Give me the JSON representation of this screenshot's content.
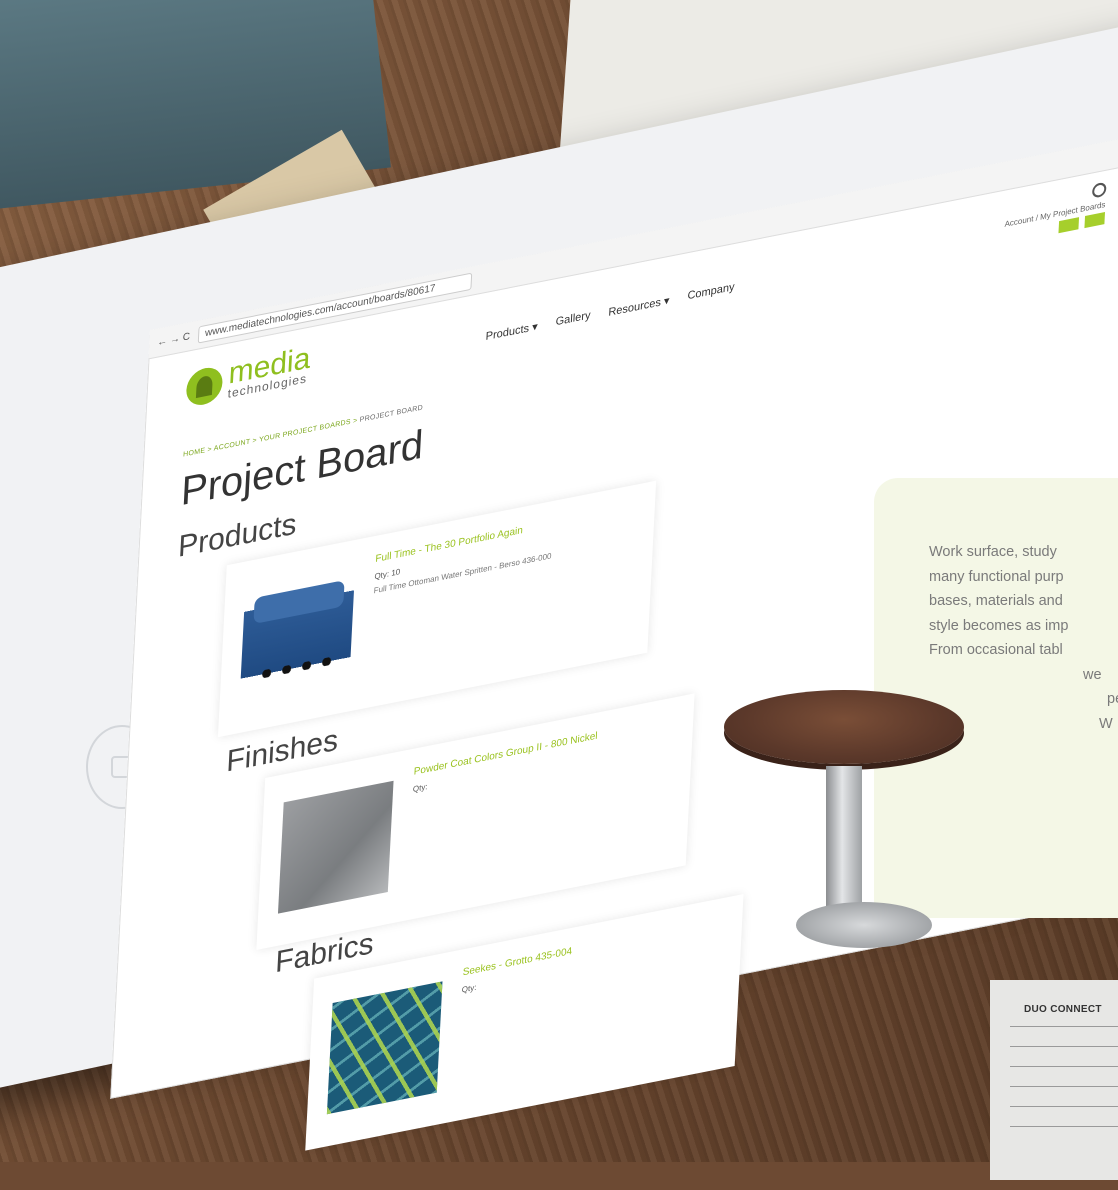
{
  "browser": {
    "url": "www.mediatechnologies.com/account/boards/80617",
    "nav_glyphs": "← → C"
  },
  "site": {
    "logo_main": "media",
    "logo_sub": "technologies",
    "nav": [
      "Products",
      "Gallery",
      "Resources",
      "Company"
    ],
    "account_link": "Account / My Project Boards",
    "buttons": [
      "",
      ""
    ]
  },
  "breadcrumb": {
    "home": "HOME",
    "account": "ACCOUNT",
    "boards": "YOUR PROJECT BOARDS",
    "current": "PROJECT BOARD"
  },
  "page": {
    "title": "Project Board",
    "products_heading": "Products",
    "finishes_heading": "Finishes",
    "fabrics_heading": "Fabrics"
  },
  "items": {
    "product_name": "Full Time - The 30 Portfolio Again",
    "product_qty": "Qty: 10",
    "product_desc": "Full Time Ottoman Water Spritten - Berso 436-000",
    "finish_name": "Powder Coat Colors Group II - 800 Nickel",
    "finish_qty": "Qty:",
    "fabric_name": "Seekes - Grotto 435-004",
    "fabric_qty": "Qty:"
  },
  "panel": {
    "lines": [
      "Work surface, study",
      "many functional purp",
      "bases, materials and",
      "style becomes as imp",
      "From occasional tabl",
      "we",
      "pe",
      "W"
    ]
  },
  "paper": {
    "label": "DUO CONNECT"
  },
  "colors": {
    "brand_green": "#8fbf1f",
    "button_green": "#a6cf2c",
    "panel_bg": "#f4f7e6"
  }
}
